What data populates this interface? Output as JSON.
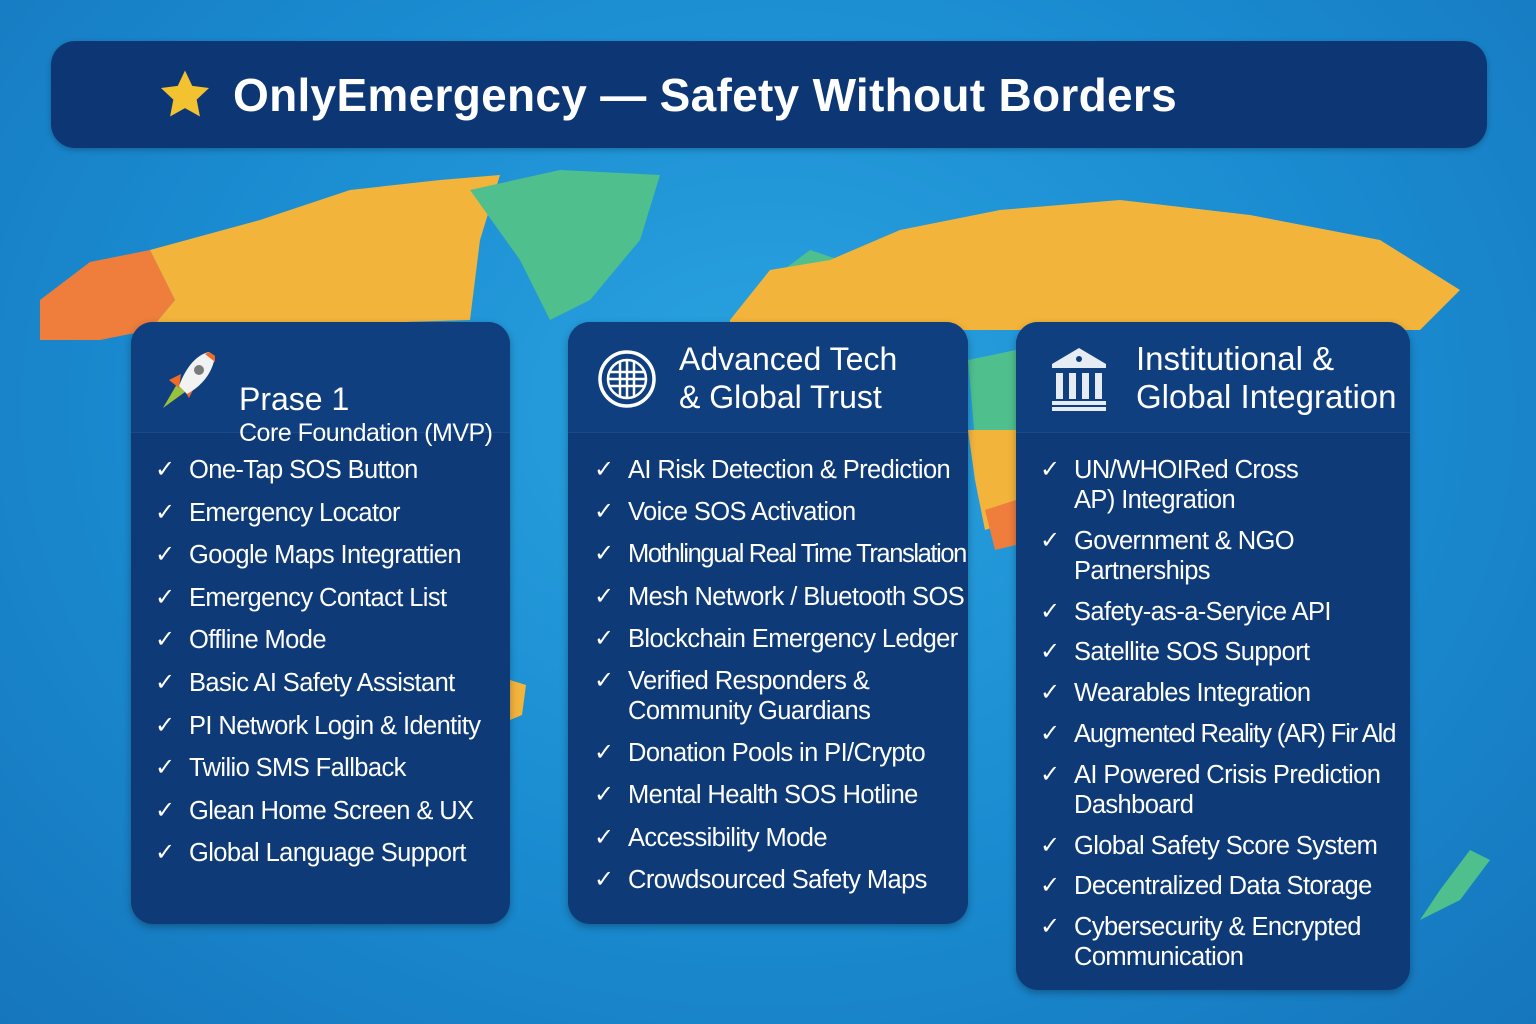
{
  "header": {
    "title": "OnlyEmergency — Safety Without Borders",
    "icon": "star-icon",
    "star_color": "#f2c230"
  },
  "colors": {
    "background": "#1a8bd0",
    "card": "#0e3a78",
    "land_orange": "#ef7d3c",
    "land_yellow": "#f3b43c",
    "land_green": "#4fc08d"
  },
  "cards": [
    {
      "icon": "rocket-icon",
      "title": "Prase 1",
      "subtitle": "Core Foundation (MVP)",
      "items": [
        "One-Tap SOS Button",
        "Emergency Locator",
        "Google Maps Integrattien",
        "Emergency Contact List",
        "Offline Mode",
        "Basic AI Safety Assistant",
        "PI Network Login & Identity",
        "Twilio SMS Fallback",
        "Glean Home Screen & UX",
        "Global Language Support"
      ]
    },
    {
      "icon": "globe-icon",
      "title": "Advanced Tech\n& Global Trust",
      "items": [
        "AI Risk Detection & Prediction",
        "Voice SOS Activation",
        "Mothlingual Real Time Translation",
        "Mesh Network / Bluetooth SOS",
        "Blockchain Emergency Ledger",
        "Verified Responders &\nCommunity Guardians",
        "Donation Pools in PI/Crypto",
        "Mental Health SOS Hotline",
        "Accessibility Mode",
        "Crowdsourced Safety Maps"
      ]
    },
    {
      "icon": "institution-icon",
      "title": "Institutional &\nGlobal Integration",
      "items": [
        "UN/WHOIRed Cross\nAP) Integration",
        "Government & NGO\nPartnerships",
        "Safety-as-a-Seryice API",
        "Satellite SOS Support",
        "Wearables Integration",
        "Augmented Reality (AR) Fir Ald",
        "AI Powered Crisis Prediction\nDashboard",
        "Global Safety Score System",
        "Decentralized Data Storage",
        "Cybersecurity & Encrypted\nCommunication"
      ]
    }
  ],
  "check_symbol": "✓"
}
